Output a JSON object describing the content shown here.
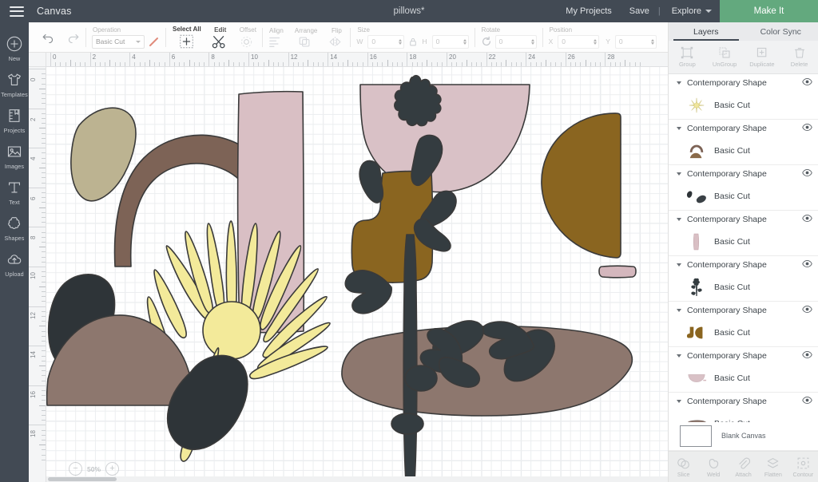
{
  "topbar": {
    "menu_icon": "hamburger-icon",
    "canvas_label": "Canvas",
    "project_title": "pillows*",
    "my_projects": "My Projects",
    "save": "Save",
    "separator": "|",
    "explore": "Explore",
    "make_it": "Make It",
    "accent_green": "#63a97e",
    "bar_color": "#424a54"
  },
  "rail": {
    "items": [
      {
        "label": "New",
        "icon": "plus-circle-icon"
      },
      {
        "label": "Templates",
        "icon": "tshirt-icon"
      },
      {
        "label": "Projects",
        "icon": "notebook-icon"
      },
      {
        "label": "Images",
        "icon": "picture-icon"
      },
      {
        "label": "Text",
        "icon": "text-t-icon"
      },
      {
        "label": "Shapes",
        "icon": "shapes-icon"
      },
      {
        "label": "Upload",
        "icon": "upload-cloud-icon"
      }
    ]
  },
  "toolbar": {
    "undo": "undo-icon",
    "redo": "redo-icon",
    "operation_caption": "Operation",
    "operation_value": "Basic Cut",
    "pen_color": "#e08a7a",
    "select_all": "Select All",
    "edit": "Edit",
    "offset": "Offset",
    "align": "Align",
    "arrange": "Arrange",
    "flip": "Flip",
    "size_caption": "Size",
    "size_w_label": "W",
    "size_w_value": "0",
    "size_h_label": "H",
    "size_h_value": "0",
    "lock_icon": "lock-icon",
    "rotate_caption": "Rotate",
    "rotate_value": "0",
    "position_caption": "Position",
    "position_x_label": "X",
    "position_x_value": "0",
    "position_y_label": "Y",
    "position_y_value": "0"
  },
  "canvas": {
    "ruler_h_labels": [
      "0",
      "2",
      "4",
      "6",
      "8",
      "10",
      "12",
      "14",
      "16",
      "18",
      "20",
      "22",
      "24",
      "26",
      "28"
    ],
    "ruler_v_labels": [
      "0",
      "2",
      "4",
      "6",
      "8",
      "10",
      "12",
      "14",
      "16",
      "18"
    ],
    "zoom_level": "50%",
    "zoom_out": "−",
    "zoom_in": "+",
    "shapes": [
      {
        "name": "tan-blob",
        "color": "#bcb391"
      },
      {
        "name": "brown-arch",
        "color": "#7d6356"
      },
      {
        "name": "pink-rectangle",
        "color": "#d9bfc4"
      },
      {
        "name": "yellow-palm-fan",
        "color": "#f3ea9a"
      },
      {
        "name": "charcoal-blob-left",
        "color": "#2e3438"
      },
      {
        "name": "charcoal-blob-right",
        "color": "#2e3438"
      },
      {
        "name": "brown-hill",
        "color": "#8d776e"
      },
      {
        "name": "pink-bowl",
        "color": "#d9c1c6"
      },
      {
        "name": "brown-boot",
        "color": "#8a6520"
      },
      {
        "name": "dark-plant",
        "color": "#343c40"
      },
      {
        "name": "brown-half-circle",
        "color": "#8a6520"
      },
      {
        "name": "pink-bar",
        "color": "#d4b7bd"
      },
      {
        "name": "brown-ground",
        "color": "#8d776e"
      },
      {
        "name": "dark-pebble",
        "color": "#343c40"
      }
    ],
    "stroke_color": "#3a3a3a"
  },
  "panel": {
    "tabs": [
      {
        "label": "Layers",
        "active": true
      },
      {
        "label": "Color Sync",
        "active": false
      }
    ],
    "actions": [
      {
        "label": "Group",
        "icon": "group-icon"
      },
      {
        "label": "UnGroup",
        "icon": "ungroup-icon"
      },
      {
        "label": "Duplicate",
        "icon": "duplicate-icon"
      },
      {
        "label": "Delete",
        "icon": "trash-icon"
      }
    ],
    "layers": [
      {
        "name": "Contemporary Shape",
        "sublabel": "Basic Cut",
        "thumb": "palm-fan-thumb",
        "visibility_icon": "eye-icon"
      },
      {
        "name": "Contemporary Shape",
        "sublabel": "Basic Cut",
        "thumb": "arch-hill-thumb",
        "visibility_icon": "eye-icon"
      },
      {
        "name": "Contemporary Shape",
        "sublabel": "Basic Cut",
        "thumb": "two-blobs-thumb",
        "visibility_icon": "eye-icon"
      },
      {
        "name": "Contemporary Shape",
        "sublabel": "Basic Cut",
        "thumb": "pink-bar-thumb",
        "visibility_icon": "eye-icon"
      },
      {
        "name": "Contemporary Shape",
        "sublabel": "Basic Cut",
        "thumb": "plant-thumb",
        "visibility_icon": "eye-icon"
      },
      {
        "name": "Contemporary Shape",
        "sublabel": "Basic Cut",
        "thumb": "boot-half-thumb",
        "visibility_icon": "eye-icon"
      },
      {
        "name": "Contemporary Shape",
        "sublabel": "Basic Cut",
        "thumb": "pink-bowl-thumb",
        "visibility_icon": "eye-icon"
      },
      {
        "name": "Contemporary Shape",
        "sublabel": "Basic Cut",
        "thumb": "brown-ground-thumb",
        "visibility_icon": "eye-icon"
      }
    ],
    "blank_canvas": "Blank Canvas",
    "bottom_actions": [
      {
        "label": "Slice",
        "icon": "slice-icon"
      },
      {
        "label": "Weld",
        "icon": "weld-icon"
      },
      {
        "label": "Attach",
        "icon": "paperclip-icon"
      },
      {
        "label": "Flatten",
        "icon": "flatten-icon"
      },
      {
        "label": "Contour",
        "icon": "contour-icon"
      }
    ]
  }
}
